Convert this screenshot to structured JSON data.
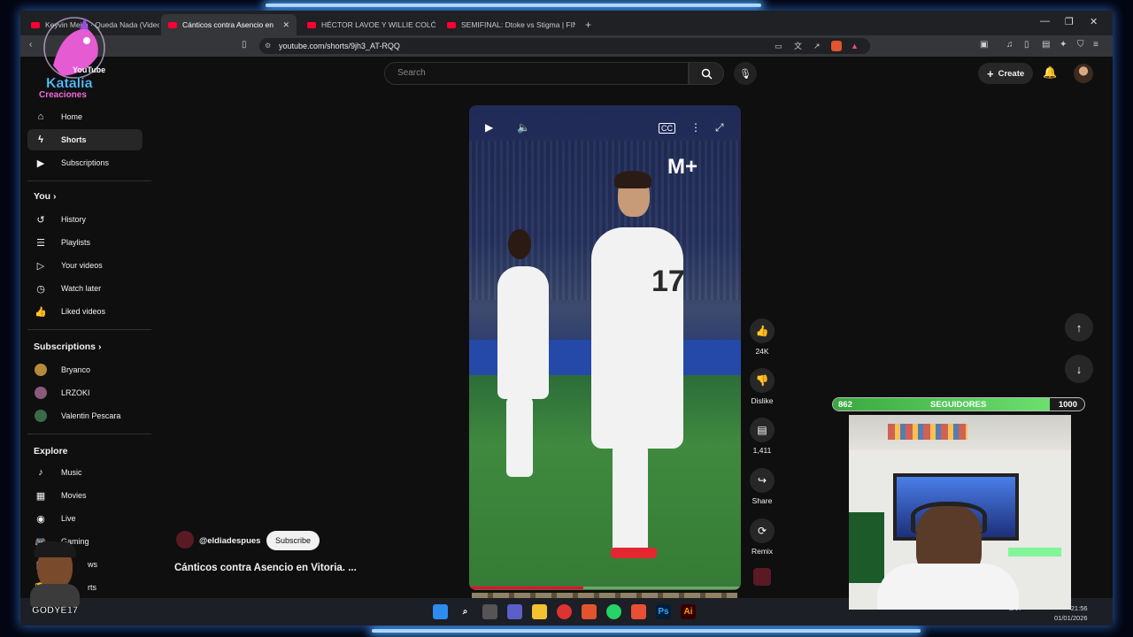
{
  "tabs": [
    {
      "label": "Keyvin Mejía · Queda Nada (Video ..."
    },
    {
      "label": "Cánticos contra Asencio en Vitoria"
    },
    {
      "label": "HÉCTOR LAVOE Y WILLIE COLÓN"
    },
    {
      "label": "SEMIFINAL: Dtoke vs Stigma | FINAL"
    }
  ],
  "address": {
    "url": "youtube.com/shorts/9jh3_AT-RQQ"
  },
  "header": {
    "search_placeholder": "Search",
    "create_label": "Create"
  },
  "sidebar": {
    "main": [
      {
        "label": "Home",
        "icon": "home-icon"
      },
      {
        "label": "Shorts",
        "icon": "shorts-icon"
      },
      {
        "label": "Subscriptions",
        "icon": "subscriptions-icon"
      }
    ],
    "you_heading": "You",
    "you": [
      {
        "label": "History"
      },
      {
        "label": "Playlists"
      },
      {
        "label": "Your videos"
      },
      {
        "label": "Watch later"
      },
      {
        "label": "Liked videos"
      }
    ],
    "subs_heading": "Subscriptions",
    "subs": [
      {
        "label": "Bryanco",
        "color": "#b58a3a"
      },
      {
        "label": "LRZOKI",
        "color": "#8a5a7a"
      },
      {
        "label": "Valentin Pescara",
        "color": "#3a6a4a"
      }
    ],
    "explore_heading": "Explore",
    "explore": [
      {
        "label": "Music"
      },
      {
        "label": "Movies"
      },
      {
        "label": "Live"
      },
      {
        "label": "Gaming"
      },
      {
        "label": "ws"
      },
      {
        "label": "rts"
      }
    ]
  },
  "video": {
    "brand": "M+",
    "progress": 0.42
  },
  "actions": {
    "likes": "24K",
    "dislike": "Dislike",
    "comments": "1,411",
    "share": "Share",
    "remix": "Remix"
  },
  "channel": {
    "handle": "@eldiadespues",
    "subscribe_label": "Subscribe"
  },
  "video_title": "Cánticos contra Asencio en Vitoria. ...",
  "taskbar": {
    "time": "21:56",
    "date": "01/01/2026",
    "lang": "LAA"
  },
  "overlay": {
    "logo_top": "YouTube",
    "logo_name": "Katalia",
    "logo_sub": "Creaciones",
    "goal_current": "862",
    "goal_label": "SEGUIDORES",
    "goal_target": "1000",
    "goal_ratio": 0.862,
    "streamer_name": "GODYE17"
  }
}
